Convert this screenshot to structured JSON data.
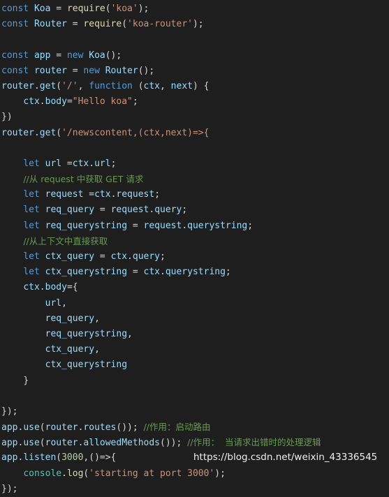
{
  "editor": {
    "background_color": "#1e1e1e",
    "default_text_color": "#d4d4d4",
    "language": "javascript",
    "font_size_px": 13,
    "line_height_px": 22,
    "theme_colors": {
      "keyword": "#569cd6",
      "identifier": "#9cdcfe",
      "function": "#dcdcaa",
      "string": "#ce9178",
      "comment": "#6a9955",
      "number": "#b5cea8",
      "class": "#4ec9b0",
      "punctuation": "#d4d4d4"
    }
  },
  "lines": [
    [
      {
        "t": "const",
        "c": "keyword"
      },
      {
        "t": " ",
        "c": "plain"
      },
      {
        "t": "Koa",
        "c": "ident"
      },
      {
        "t": " ",
        "c": "plain"
      },
      {
        "t": "=",
        "c": "operator"
      },
      {
        "t": " ",
        "c": "plain"
      },
      {
        "t": "require",
        "c": "func"
      },
      {
        "t": "(",
        "c": "punct"
      },
      {
        "t": "'koa'",
        "c": "string"
      },
      {
        "t": ");",
        "c": "punct"
      }
    ],
    [
      {
        "t": "const",
        "c": "keyword"
      },
      {
        "t": " ",
        "c": "plain"
      },
      {
        "t": "Router",
        "c": "ident"
      },
      {
        "t": " ",
        "c": "plain"
      },
      {
        "t": "=",
        "c": "operator"
      },
      {
        "t": " ",
        "c": "plain"
      },
      {
        "t": "require",
        "c": "func"
      },
      {
        "t": "(",
        "c": "punct"
      },
      {
        "t": "'koa-router'",
        "c": "string"
      },
      {
        "t": ");",
        "c": "punct"
      }
    ],
    [],
    [
      {
        "t": "const",
        "c": "keyword"
      },
      {
        "t": " ",
        "c": "plain"
      },
      {
        "t": "app",
        "c": "ident"
      },
      {
        "t": " ",
        "c": "plain"
      },
      {
        "t": "=",
        "c": "operator"
      },
      {
        "t": " ",
        "c": "plain"
      },
      {
        "t": "new",
        "c": "keyword"
      },
      {
        "t": " ",
        "c": "plain"
      },
      {
        "t": "Koa",
        "c": "ident"
      },
      {
        "t": "();",
        "c": "punct"
      }
    ],
    [
      {
        "t": "const",
        "c": "keyword"
      },
      {
        "t": " ",
        "c": "plain"
      },
      {
        "t": "router",
        "c": "ident"
      },
      {
        "t": " ",
        "c": "plain"
      },
      {
        "t": "=",
        "c": "operator"
      },
      {
        "t": " ",
        "c": "plain"
      },
      {
        "t": "new",
        "c": "keyword"
      },
      {
        "t": " ",
        "c": "plain"
      },
      {
        "t": "Router",
        "c": "ident"
      },
      {
        "t": "();",
        "c": "punct"
      }
    ],
    [
      {
        "t": "router",
        "c": "ident"
      },
      {
        "t": ".",
        "c": "punct"
      },
      {
        "t": "get",
        "c": "ident"
      },
      {
        "t": "(",
        "c": "punct"
      },
      {
        "t": "'/'",
        "c": "string"
      },
      {
        "t": ", ",
        "c": "punct"
      },
      {
        "t": "function",
        "c": "keyword"
      },
      {
        "t": " ",
        "c": "plain"
      },
      {
        "t": "(",
        "c": "punct"
      },
      {
        "t": "ctx",
        "c": "ident"
      },
      {
        "t": ", ",
        "c": "punct"
      },
      {
        "t": "next",
        "c": "ident"
      },
      {
        "t": ") {",
        "c": "punct"
      }
    ],
    [
      {
        "t": "    ",
        "c": "plain"
      },
      {
        "t": "ctx",
        "c": "ident"
      },
      {
        "t": ".",
        "c": "punct"
      },
      {
        "t": "body",
        "c": "ident"
      },
      {
        "t": "=",
        "c": "operator"
      },
      {
        "t": "\"Hello koa\"",
        "c": "string"
      },
      {
        "t": ";",
        "c": "punct"
      }
    ],
    [
      {
        "t": "})",
        "c": "punct"
      }
    ],
    [
      {
        "t": "router",
        "c": "ident"
      },
      {
        "t": ".",
        "c": "punct"
      },
      {
        "t": "get",
        "c": "ident"
      },
      {
        "t": "(",
        "c": "punct"
      },
      {
        "t": "'/newscontent,(ctx,next)=>{",
        "c": "string"
      }
    ],
    [],
    [
      {
        "t": "    ",
        "c": "plain"
      },
      {
        "t": "let",
        "c": "keyword"
      },
      {
        "t": " ",
        "c": "plain"
      },
      {
        "t": "url",
        "c": "ident"
      },
      {
        "t": " =",
        "c": "operator"
      },
      {
        "t": "ctx",
        "c": "ident"
      },
      {
        "t": ".",
        "c": "punct"
      },
      {
        "t": "url",
        "c": "ident"
      },
      {
        "t": ";",
        "c": "punct"
      }
    ],
    [
      {
        "t": "    ",
        "c": "plain"
      },
      {
        "t": "//从 request 中获取 GET 请求",
        "c": "comment",
        "cjk": true
      }
    ],
    [
      {
        "t": "    ",
        "c": "plain"
      },
      {
        "t": "let",
        "c": "keyword"
      },
      {
        "t": " ",
        "c": "plain"
      },
      {
        "t": "request",
        "c": "ident"
      },
      {
        "t": " =",
        "c": "operator"
      },
      {
        "t": "ctx",
        "c": "ident"
      },
      {
        "t": ".",
        "c": "punct"
      },
      {
        "t": "request",
        "c": "ident"
      },
      {
        "t": ";",
        "c": "punct"
      }
    ],
    [
      {
        "t": "    ",
        "c": "plain"
      },
      {
        "t": "let",
        "c": "keyword"
      },
      {
        "t": " ",
        "c": "plain"
      },
      {
        "t": "req_query",
        "c": "ident"
      },
      {
        "t": " ",
        "c": "plain"
      },
      {
        "t": "=",
        "c": "operator"
      },
      {
        "t": " ",
        "c": "plain"
      },
      {
        "t": "request",
        "c": "ident"
      },
      {
        "t": ".",
        "c": "punct"
      },
      {
        "t": "query",
        "c": "ident"
      },
      {
        "t": ";",
        "c": "punct"
      }
    ],
    [
      {
        "t": "    ",
        "c": "plain"
      },
      {
        "t": "let",
        "c": "keyword"
      },
      {
        "t": " ",
        "c": "plain"
      },
      {
        "t": "req_querystring",
        "c": "ident"
      },
      {
        "t": " ",
        "c": "plain"
      },
      {
        "t": "=",
        "c": "operator"
      },
      {
        "t": " ",
        "c": "plain"
      },
      {
        "t": "request",
        "c": "ident"
      },
      {
        "t": ".",
        "c": "punct"
      },
      {
        "t": "querystring",
        "c": "ident"
      },
      {
        "t": ";",
        "c": "punct"
      }
    ],
    [
      {
        "t": "    ",
        "c": "plain"
      },
      {
        "t": "//从上下文中直接获取",
        "c": "comment",
        "cjk": true
      }
    ],
    [
      {
        "t": "    ",
        "c": "plain"
      },
      {
        "t": "let",
        "c": "keyword"
      },
      {
        "t": " ",
        "c": "plain"
      },
      {
        "t": "ctx_query",
        "c": "ident"
      },
      {
        "t": " ",
        "c": "plain"
      },
      {
        "t": "=",
        "c": "operator"
      },
      {
        "t": " ",
        "c": "plain"
      },
      {
        "t": "ctx",
        "c": "ident"
      },
      {
        "t": ".",
        "c": "punct"
      },
      {
        "t": "query",
        "c": "ident"
      },
      {
        "t": ";",
        "c": "punct"
      }
    ],
    [
      {
        "t": "    ",
        "c": "plain"
      },
      {
        "t": "let",
        "c": "keyword"
      },
      {
        "t": " ",
        "c": "plain"
      },
      {
        "t": "ctx_querystring",
        "c": "ident"
      },
      {
        "t": " ",
        "c": "plain"
      },
      {
        "t": "=",
        "c": "operator"
      },
      {
        "t": " ",
        "c": "plain"
      },
      {
        "t": "ctx",
        "c": "ident"
      },
      {
        "t": ".",
        "c": "punct"
      },
      {
        "t": "querystring",
        "c": "ident"
      },
      {
        "t": ";",
        "c": "punct"
      }
    ],
    [
      {
        "t": "    ",
        "c": "plain"
      },
      {
        "t": "ctx",
        "c": "ident"
      },
      {
        "t": ".",
        "c": "punct"
      },
      {
        "t": "body",
        "c": "ident"
      },
      {
        "t": "={",
        "c": "punct"
      }
    ],
    [
      {
        "t": "        ",
        "c": "plain"
      },
      {
        "t": "url",
        "c": "ident"
      },
      {
        "t": ",",
        "c": "punct"
      }
    ],
    [
      {
        "t": "        ",
        "c": "plain"
      },
      {
        "t": "req_query",
        "c": "ident"
      },
      {
        "t": ",",
        "c": "punct"
      }
    ],
    [
      {
        "t": "        ",
        "c": "plain"
      },
      {
        "t": "req_querystring",
        "c": "ident"
      },
      {
        "t": ",",
        "c": "punct"
      }
    ],
    [
      {
        "t": "        ",
        "c": "plain"
      },
      {
        "t": "ctx_query",
        "c": "ident"
      },
      {
        "t": ",",
        "c": "punct"
      }
    ],
    [
      {
        "t": "        ",
        "c": "plain"
      },
      {
        "t": "ctx_querystring",
        "c": "ident"
      }
    ],
    [
      {
        "t": "    ",
        "c": "plain"
      },
      {
        "t": "}",
        "c": "punct"
      }
    ],
    [],
    [
      {
        "t": "});",
        "c": "punct"
      }
    ],
    [
      {
        "t": "app",
        "c": "ident"
      },
      {
        "t": ".",
        "c": "punct"
      },
      {
        "t": "use",
        "c": "ident"
      },
      {
        "t": "(",
        "c": "punct"
      },
      {
        "t": "router",
        "c": "ident"
      },
      {
        "t": ".",
        "c": "punct"
      },
      {
        "t": "routes",
        "c": "ident"
      },
      {
        "t": "());",
        "c": "punct"
      },
      {
        "t": " ",
        "c": "plain"
      },
      {
        "t": "//作用：启动路由",
        "c": "comment",
        "cjk": true
      }
    ],
    [
      {
        "t": "app",
        "c": "ident"
      },
      {
        "t": ".",
        "c": "punct"
      },
      {
        "t": "use",
        "c": "ident"
      },
      {
        "t": "(",
        "c": "punct"
      },
      {
        "t": "router",
        "c": "ident"
      },
      {
        "t": ".",
        "c": "punct"
      },
      {
        "t": "allowedMethods",
        "c": "ident"
      },
      {
        "t": "());",
        "c": "punct"
      },
      {
        "t": " ",
        "c": "plain"
      },
      {
        "t": "//作用：  当请求出错时的处理逻辑",
        "c": "comment",
        "cjk": true
      }
    ],
    [
      {
        "t": "app",
        "c": "ident"
      },
      {
        "t": ".",
        "c": "punct"
      },
      {
        "t": "listen",
        "c": "ident"
      },
      {
        "t": "(",
        "c": "punct"
      },
      {
        "t": "3000",
        "c": "number"
      },
      {
        "t": ",()=>{",
        "c": "punct"
      }
    ],
    [
      {
        "t": "    ",
        "c": "plain"
      },
      {
        "t": "console",
        "c": "class"
      },
      {
        "t": ".",
        "c": "punct"
      },
      {
        "t": "log",
        "c": "func"
      },
      {
        "t": "(",
        "c": "punct"
      },
      {
        "t": "'starting at port 3000'",
        "c": "string"
      },
      {
        "t": ");",
        "c": "punct"
      }
    ],
    [
      {
        "t": "});",
        "c": "punct"
      }
    ]
  ],
  "watermark": {
    "text": "https://blog.csdn.net/weixin_43336545",
    "color": "#f0f0f0"
  }
}
